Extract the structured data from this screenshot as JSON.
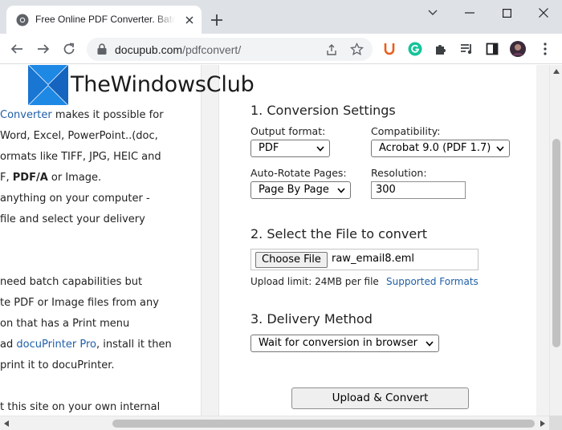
{
  "browser": {
    "tab_title": "Free Online PDF Converter. Batch Convert",
    "url_host": "docupub.com",
    "url_path": "/pdfconvert/",
    "icons": [
      "chrome-favicon",
      "close-icon",
      "plus-icon",
      "chevron-down-icon",
      "minimize-icon",
      "maximize-icon",
      "close-window-icon",
      "back-arrow-icon",
      "forward-arrow-icon",
      "reload-icon",
      "lock-icon",
      "share-icon",
      "star-icon",
      "ublock-icon",
      "grammarly-icon",
      "puzzle-icon",
      "reading-list-icon",
      "side-panel-icon",
      "avatar",
      "kebab-menu-icon"
    ]
  },
  "logo": {
    "text": "TheWindowsClub",
    "colors": {
      "blue": "#1e88e5",
      "dark": "#0d47a1"
    }
  },
  "left_text": {
    "line1_link": "Converter",
    "line1_rest": " makes it possible for",
    "line2": " Word, Excel, PowerPoint..(doc,",
    "line3": "ormats like TIFF, JPG, HEIC and",
    "line4_a": "F, ",
    "line4_b": "PDF/A",
    "line4_c": " or Image.",
    "line5": "anything on your computer -",
    "line6": " file and select your delivery",
    "line7": " need batch capabilities but",
    "line8": "te PDF or Image files from any",
    "line9": "on that has a Print menu",
    "line10_a": "ad ",
    "line10_link": "docuPrinter Pro",
    "line10_c": ", install it then",
    "line11": " print it to docuPrinter.",
    "line12": "t this site on your own internal"
  },
  "form": {
    "section1": "1. Conversion Settings",
    "output_format_label": "Output format:",
    "output_format_value": "PDF",
    "compatibility_label": "Compatibility:",
    "compatibility_value": "Acrobat 9.0 (PDF 1.7)",
    "autorotate_label": "Auto-Rotate Pages:",
    "autorotate_value": "Page By Page",
    "resolution_label": "Resolution:",
    "resolution_value": "300",
    "section2": "2. Select the File to convert",
    "choose_file": "Choose File",
    "file_name": "raw_email8.eml",
    "upload_limit": "Upload limit: 24MB per file",
    "supported_formats": "Supported Formats",
    "section3": "3. Delivery Method",
    "delivery_value": "Wait for conversion in browser",
    "upload_button": "Upload & Convert"
  }
}
